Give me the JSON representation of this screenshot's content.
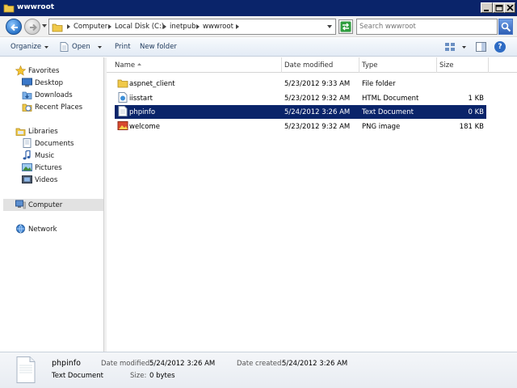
{
  "window": {
    "title": "wwwroot"
  },
  "address": {
    "breadcrumb": [
      "Computer",
      "Local Disk (C:)",
      "inetpub",
      "wwwroot"
    ],
    "search_placeholder": "Search wwwroot"
  },
  "toolbar": {
    "organize": "Organize",
    "open": "Open",
    "print": "Print",
    "new_folder": "New folder"
  },
  "nav": {
    "favorites": "Favorites",
    "desktop": "Desktop",
    "downloads": "Downloads",
    "recent_places": "Recent Places",
    "libraries": "Libraries",
    "documents": "Documents",
    "music": "Music",
    "pictures": "Pictures",
    "videos": "Videos",
    "computer": "Computer",
    "network": "Network"
  },
  "columns": {
    "name": "Name",
    "date_modified": "Date modified",
    "type": "Type",
    "size": "Size"
  },
  "files": [
    {
      "name": "aspnet_client",
      "date": "5/23/2012 9:33 AM",
      "type": "File folder",
      "size": "",
      "icon": "folder-icon"
    },
    {
      "name": "iisstart",
      "date": "5/23/2012 9:32 AM",
      "type": "HTML Document",
      "size": "1 KB",
      "icon": "html-file-icon"
    },
    {
      "name": "phpinfo",
      "date": "5/24/2012 3:26 AM",
      "type": "Text Document",
      "size": "0 KB",
      "icon": "text-file-icon",
      "selected": true
    },
    {
      "name": "welcome",
      "date": "5/23/2012 9:32 AM",
      "type": "PNG image",
      "size": "181 KB",
      "icon": "png-file-icon"
    }
  ],
  "details": {
    "name": "phpinfo",
    "type": "Text Document",
    "date_modified_label": "Date modified:",
    "date_modified": "5/24/2012 3:26 AM",
    "size_label": "Size:",
    "size": "0 bytes",
    "date_created_label": "Date created:",
    "date_created": "5/24/2012 3:26 AM"
  },
  "colors": {
    "title_bar": "#0a246a",
    "selection": "#0a246a"
  }
}
